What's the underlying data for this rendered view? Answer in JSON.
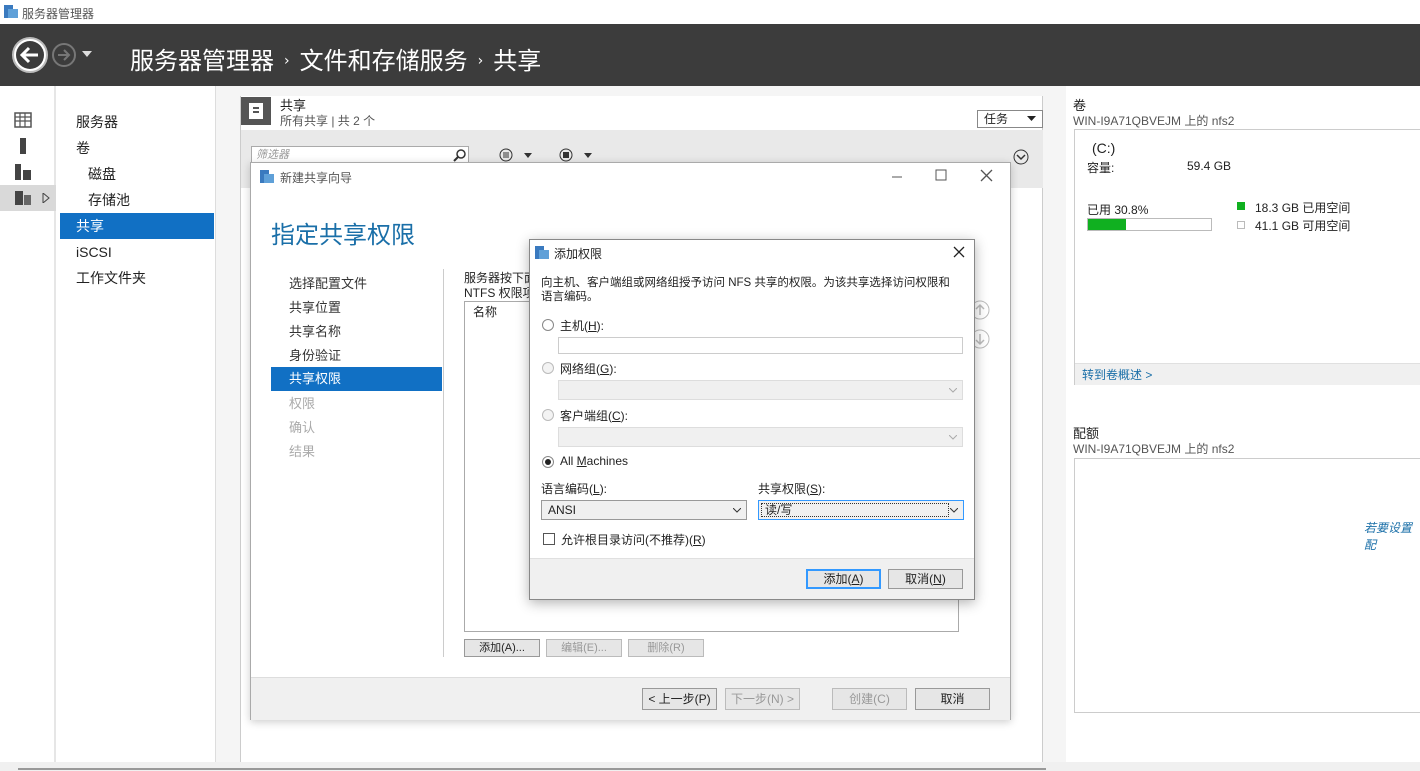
{
  "window": {
    "title": "服务器管理器"
  },
  "header": {
    "crumbs": [
      "服务器管理器",
      "文件和存储服务",
      "共享"
    ],
    "sep": "›"
  },
  "nav": {
    "items": [
      {
        "label": "服务器",
        "sub": false
      },
      {
        "label": "卷",
        "sub": false
      },
      {
        "label": "磁盘",
        "sub": true
      },
      {
        "label": "存储池",
        "sub": true
      },
      {
        "label": "共享",
        "sub": false,
        "selected": true
      },
      {
        "label": "iSCSI",
        "sub": false
      },
      {
        "label": "工作文件夹",
        "sub": false
      }
    ]
  },
  "shares": {
    "title": "共享",
    "subtitle": "所有共享 | 共 2 个",
    "task_label": "任务",
    "filter_placeholder": "筛选器"
  },
  "volume": {
    "title": "卷",
    "subtitle": "WIN-I9A71QBVEJM 上的 nfs2",
    "drive": "(C:)",
    "capacity_label": "容量:",
    "capacity_value": "59.4 GB",
    "used_label": "已用 30.8%",
    "used_pct": 30.8,
    "used_space": "18.3 GB 已用空间",
    "free_space": "41.1 GB 可用空间",
    "link": "转到卷概述 >"
  },
  "quota": {
    "title": "配额",
    "subtitle": "WIN-I9A71QBVEJM 上的 nfs2",
    "link": "若要设置配"
  },
  "wizard": {
    "title": "新建共享向导",
    "heading": "指定共享权限",
    "steps": [
      {
        "label": "选择配置文件",
        "state": "normal"
      },
      {
        "label": "共享位置",
        "state": "normal"
      },
      {
        "label": "共享名称",
        "state": "normal"
      },
      {
        "label": "身份验证",
        "state": "normal"
      },
      {
        "label": "共享权限",
        "state": "selected"
      },
      {
        "label": "权限",
        "state": "disabled"
      },
      {
        "label": "确认",
        "state": "disabled"
      },
      {
        "label": "结果",
        "state": "disabled"
      }
    ],
    "desc_line1": "服务器按下面",
    "desc_line2": "NTFS 权限项",
    "list_header": "名称",
    "add_btn": "添加(A)...",
    "edit_btn": "编辑(E)...",
    "remove_btn": "删除(R)",
    "prev_btn": "< 上一步(P)",
    "next_btn": "下一步(N) >",
    "create_btn": "创建(C)",
    "cancel_btn": "取消"
  },
  "dialog": {
    "title": "添加权限",
    "desc": "向主机、客户端组或网络组授予访问 NFS 共享的权限。为该共享选择访问权限和语言编码。",
    "host_label": "主机(",
    "host_key": "H",
    "netgroup_label": "网络组(",
    "netgroup_key": "G",
    "clientgroup_label": "客户端组(",
    "clientgroup_key": "C",
    "all_machines_a": "All ",
    "all_machines_key": "M",
    "all_machines_b": "achines",
    "encoding_label": "语言编码(",
    "encoding_key": "L",
    "encoding_value": "ANSI",
    "perm_label": "共享权限(",
    "perm_key": "S",
    "perm_value": "读/写",
    "root_label": "允许根目录访问(不推荐)(",
    "root_key": "R",
    "add_btn": "添加(",
    "add_key": "A",
    "cancel_btn": "取消(",
    "cancel_key": "N",
    "close_suffix": "):"
  }
}
